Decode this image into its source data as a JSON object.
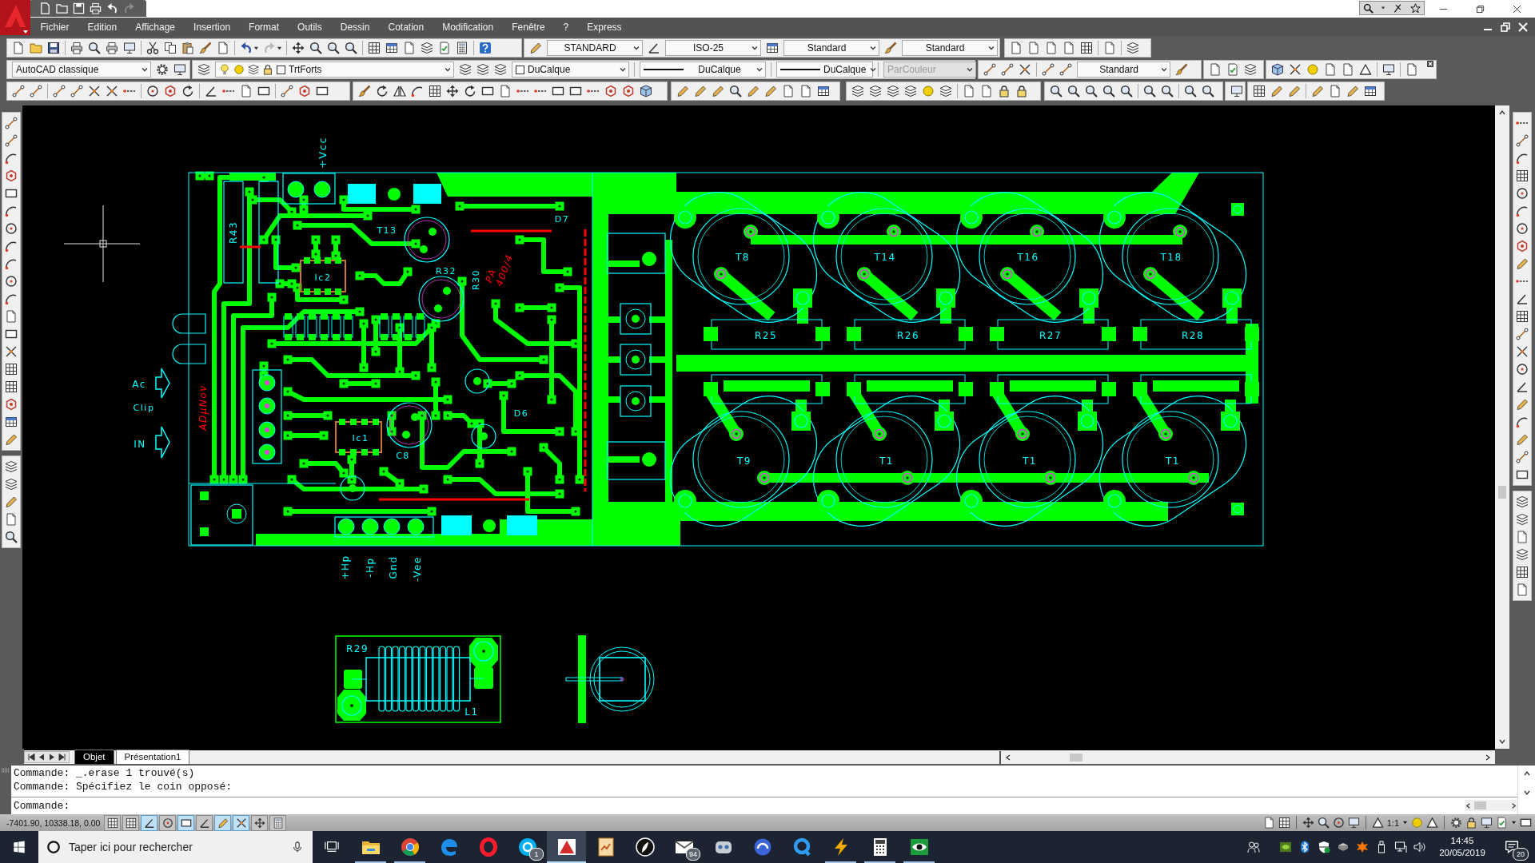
{
  "menu_items": [
    "Fichier",
    "Edition",
    "Affichage",
    "Insertion",
    "Format",
    "Outils",
    "Dessin",
    "Cotation",
    "Modification",
    "Fenêtre",
    "?",
    "Express"
  ],
  "toolbar_dropdowns": [
    {
      "value": "STANDARD",
      "disabled": false
    },
    {
      "value": "ISO-25",
      "disabled": false
    },
    {
      "value": "Standard",
      "disabled": false
    },
    {
      "value": "Standard",
      "disabled": false
    },
    {
      "value": "AutoCAD classique",
      "disabled": false
    },
    {
      "value": "TrtForts",
      "disabled": false
    },
    {
      "value": "DuCalque",
      "disabled": false
    },
    {
      "value": "DuCalque",
      "disabled": false
    },
    {
      "value": "DuCalque",
      "disabled": false
    },
    {
      "value": "ParCouleur",
      "disabled": true
    },
    {
      "value": "Standard",
      "disabled": false
    }
  ],
  "drawing": {
    "labels": [
      {
        "text": "+Vcc",
        "color": "#00ffff"
      },
      {
        "text": "R43",
        "color": "#00ffff"
      },
      {
        "text": "T13",
        "color": "#00ffff"
      },
      {
        "text": "Ic2",
        "color": "#00ffff"
      },
      {
        "text": "R32",
        "color": "#00ffff"
      },
      {
        "text": "R30",
        "color": "#00ffff"
      },
      {
        "text": "D7",
        "color": "#00ffff"
      },
      {
        "text": "PA",
        "color": "#ff0000"
      },
      {
        "text": "400/4",
        "color": "#ff0000"
      },
      {
        "text": "T8",
        "color": "#00ffff"
      },
      {
        "text": "T14",
        "color": "#00ffff"
      },
      {
        "text": "T16",
        "color": "#00ffff"
      },
      {
        "text": "T18",
        "color": "#00ffff"
      },
      {
        "text": "Ac",
        "color": "#00ffff"
      },
      {
        "text": "Clip",
        "color": "#00ffff"
      },
      {
        "text": "IN",
        "color": "#00ffff"
      },
      {
        "text": "ADµNov",
        "color": "#ff0000"
      },
      {
        "text": "R25",
        "color": "#00ffff"
      },
      {
        "text": "R26",
        "color": "#00ffff"
      },
      {
        "text": "R27",
        "color": "#00ffff"
      },
      {
        "text": "R28",
        "color": "#00ffff"
      },
      {
        "text": "D6",
        "color": "#00ffff"
      },
      {
        "text": "Ic1",
        "color": "#00ffff"
      },
      {
        "text": "C8",
        "color": "#00ffff"
      },
      {
        "text": "T9",
        "color": "#00ffff"
      },
      {
        "text": "T1",
        "color": "#00ffff"
      },
      {
        "text": "T1",
        "color": "#00ffff"
      },
      {
        "text": "T1",
        "color": "#00ffff"
      },
      {
        "text": "+Hp",
        "color": "#00ffff"
      },
      {
        "text": "-Hp",
        "color": "#00ffff"
      },
      {
        "text": "Gnd",
        "color": "#00ffff"
      },
      {
        "text": "-Vee",
        "color": "#00ffff"
      },
      {
        "text": "R29",
        "color": "#00ffff"
      },
      {
        "text": "L1",
        "color": "#00ffff"
      }
    ]
  },
  "layout_tabs": [
    {
      "label": "Objet",
      "selected": true
    },
    {
      "label": "Présentation1",
      "selected": false
    }
  ],
  "command_line": {
    "history": [
      "Commande: _.erase 1 trouvé(s)",
      "Commande: Spécifiez le coin opposé:"
    ],
    "prompt": "Commande:"
  },
  "status_bar": {
    "coordinates": "-7401.90, 10338.18, 0.00",
    "toggles": [
      {
        "on": false
      },
      {
        "on": false
      },
      {
        "on": true
      },
      {
        "on": false
      },
      {
        "on": true
      },
      {
        "on": false
      },
      {
        "on": true
      },
      {
        "on": true
      },
      {
        "on": false
      },
      {
        "on": false
      }
    ],
    "annotation_scale": "1:1"
  },
  "taskbar": {
    "search": {
      "placeholder": "Taper ici pour rechercher"
    },
    "apps": [
      {
        "running": true,
        "active": false
      },
      {
        "running": true,
        "active": false
      },
      {
        "running": false,
        "active": false
      },
      {
        "running": false,
        "active": false
      },
      {
        "running": false,
        "active": false,
        "badge": "1"
      },
      {
        "running": true,
        "active": true
      },
      {
        "running": false,
        "active": false
      },
      {
        "running": false,
        "active": false
      },
      {
        "running": false,
        "active": false,
        "badge": "94"
      },
      {
        "running": false,
        "active": false
      },
      {
        "running": false,
        "active": false
      },
      {
        "running": false,
        "active": false
      },
      {
        "running": true,
        "active": false
      },
      {
        "running": true,
        "active": false
      },
      {
        "running": true,
        "active": false
      }
    ],
    "clock": {
      "time": "14:45",
      "date": "20/05/2019"
    },
    "notification_count": "20"
  }
}
